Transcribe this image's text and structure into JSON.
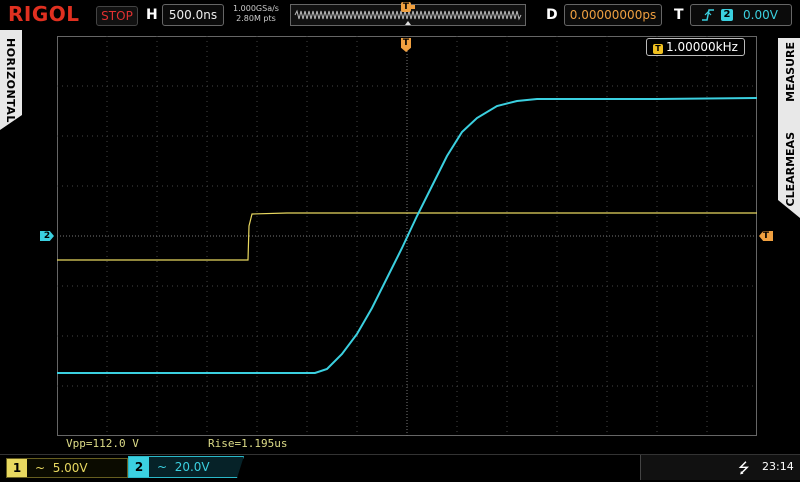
{
  "brand": "RIGOL",
  "run_state": "STOP",
  "horizontal": {
    "label": "H",
    "timebase": "500.0ns",
    "sample_rate": "1.000GSa/s",
    "memory_depth": "2.80M pts"
  },
  "delay": {
    "label": "D",
    "value": "0.00000000ps"
  },
  "trigger": {
    "label": "T",
    "edge_icon": "rising-edge-icon",
    "source": "2",
    "level": "0.00V"
  },
  "side_panels": {
    "left": "HORIZONTAL",
    "right_top": "MEASURE",
    "right_bottom": "CLEARMEAS"
  },
  "frequency_readout": {
    "badge": "T",
    "value": "1.00000kHz"
  },
  "measurements": {
    "vpp": "Vpp=112.0 V",
    "rise": "Rise=1.195us"
  },
  "markers": {
    "ch2_ref": "2",
    "trigger_level": "T",
    "trigger_pos": "T"
  },
  "channels": [
    {
      "num": "1",
      "coupling_icon": "ac-coupling-icon",
      "coupling_glyph": "~",
      "scale": "5.00V",
      "color": "#e8d860"
    },
    {
      "num": "2",
      "coupling_icon": "ac-coupling-icon",
      "coupling_glyph": "~",
      "scale": "20.0V",
      "color": "#3bd0e0"
    }
  ],
  "status": {
    "usb_icon": "usb-icon",
    "usb_glyph": "⭍",
    "time": "23:14"
  },
  "colors": {
    "ch1": "#e8d860",
    "ch2": "#3bd0e0",
    "trigger": "#f0a040",
    "stop": "#e03030",
    "brand": "#e03020"
  }
}
